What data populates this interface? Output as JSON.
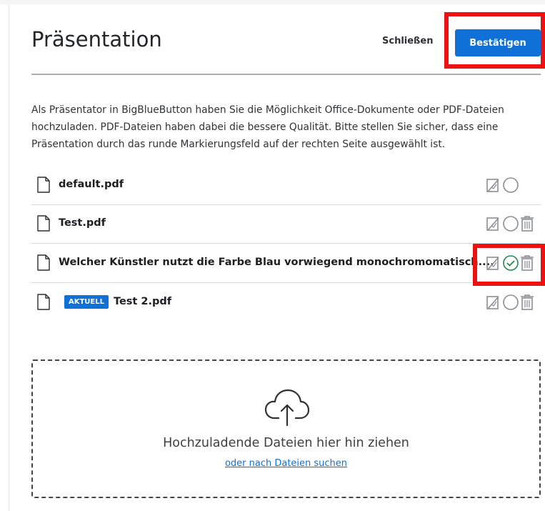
{
  "modal": {
    "title": "Präsentation",
    "close_label": "Schließen",
    "confirm_label": "Bestätigen"
  },
  "description": "Als Präsentator in BigBlueButton haben Sie die Möglichkeit Office-Dokumente oder PDF-Dateien hochzuladen. PDF-Dateien haben dabei die bessere Qualität. Bitte stellen Sie sicher, dass eine Präsentation durch das runde Markierungsfeld auf der rechten Seite ausgewählt ist.",
  "files": [
    {
      "name": "default.pdf",
      "badge": "",
      "selected": false,
      "deletable": false
    },
    {
      "name": "Test.pdf",
      "badge": "",
      "selected": false,
      "deletable": true
    },
    {
      "name": "Welcher Künstler nutzt die Farbe Blau vorwiegend monochromomatisch....",
      "badge": "",
      "selected": true,
      "deletable": true
    },
    {
      "name": "Test 2.pdf",
      "badge": "AKTUELL",
      "selected": false,
      "deletable": true
    }
  ],
  "dropzone": {
    "text": "Hochzuladende Dateien hier hin ziehen",
    "browse_link": "oder nach Dateien suchen"
  },
  "icons": {
    "file": "file-icon",
    "download_toggle": "download-disabled-icon",
    "select": "radio-circle-icon",
    "selected": "check-circle-icon",
    "delete": "trash-icon",
    "upload": "cloud-upload-icon"
  },
  "colors": {
    "primary": "#0f70d7",
    "selected_check": "#1f8a4c",
    "highlight": "#ee1111"
  }
}
